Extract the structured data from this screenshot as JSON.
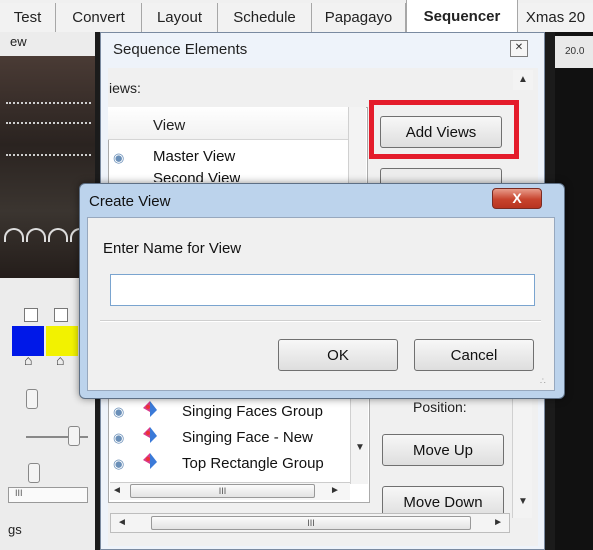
{
  "tabs": [
    "Test",
    "Convert",
    "Layout",
    "Schedule",
    "Papagayo",
    "Sequencer",
    "Xmas 20"
  ],
  "active_tab": "Sequencer",
  "left_panel": {
    "title_fragment": "ew",
    "scrollbar_grip": "III",
    "bottom_label_fragment": "gs",
    "swatch_colors": [
      "#0018e8",
      "#f2f200"
    ]
  },
  "timeline": {
    "ruler_label": "20.0"
  },
  "sequence_elements": {
    "title": "Sequence Elements",
    "views_label": "iews:",
    "views_header": "View",
    "views": [
      "Master View",
      "Second View"
    ],
    "add_views_label": "Add Views",
    "position_label": "Position:",
    "move_up_label": "Move Up",
    "move_down_label": "Move Down",
    "elements": [
      "Singing Faces Group",
      "Singing Face - New",
      "Top Rectangle Group"
    ],
    "scroll_grip": "III",
    "highlight_color": "#e41c2b"
  },
  "create_view": {
    "title": "Create View",
    "prompt": "Enter Name for View",
    "input_value": "",
    "ok_label": "OK",
    "cancel_label": "Cancel",
    "close_label": "X"
  }
}
